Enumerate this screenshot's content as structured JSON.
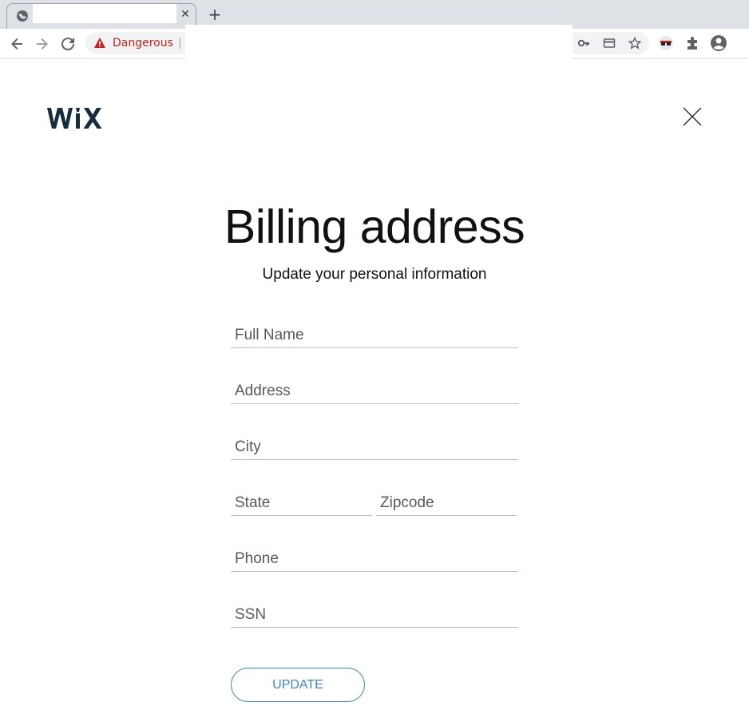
{
  "browser": {
    "tab_title": "",
    "tab_close": "✕",
    "new_tab": "+",
    "security_label": "Dangerous"
  },
  "colors": {
    "danger": "#c5221f",
    "accent": "#3f86c9"
  },
  "icons": [
    "globe-icon",
    "back-icon",
    "forward-icon",
    "reload-icon",
    "warning-icon",
    "key-icon",
    "card-icon",
    "star-icon",
    "incognito-icon",
    "puzzle-icon",
    "profile-icon",
    "close-icon"
  ],
  "page": {
    "logo_text": "WiX",
    "title": "Billing address",
    "subtitle": "Update your personal information",
    "fields": {
      "full_name": {
        "placeholder": "Full Name",
        "value": ""
      },
      "address": {
        "placeholder": "Address",
        "value": ""
      },
      "city": {
        "placeholder": "City",
        "value": ""
      },
      "state": {
        "placeholder": "State",
        "value": ""
      },
      "zipcode": {
        "placeholder": "Zipcode",
        "value": ""
      },
      "phone": {
        "placeholder": "Phone",
        "value": ""
      },
      "ssn": {
        "placeholder": "SSN",
        "value": ""
      }
    },
    "update_label": "UPDATE"
  }
}
